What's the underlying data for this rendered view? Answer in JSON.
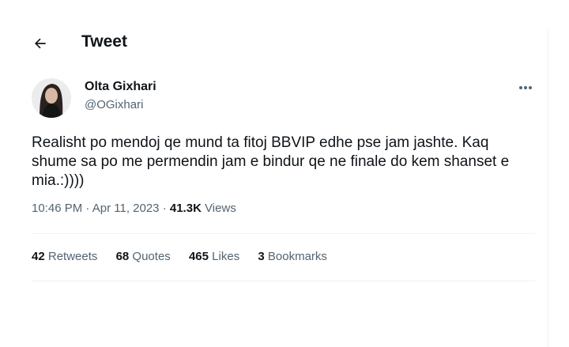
{
  "header": {
    "title": "Tweet"
  },
  "tweet": {
    "display_name": "Olta Gixhari",
    "handle": "@OGixhari",
    "text": "Realisht po mendoj qe mund ta fitoj BBVIP edhe pse jam jashte. Kaq shume sa po me permendin jam e bindur qe ne finale do kem shanset e mia.:))))",
    "time": "10:46 PM",
    "separator": "·",
    "date": "Apr 11, 2023",
    "views_count": "41.3K",
    "views_label": "Views"
  },
  "stats": {
    "retweets_count": "42",
    "retweets_label": "Retweets",
    "quotes_count": "68",
    "quotes_label": "Quotes",
    "likes_count": "465",
    "likes_label": "Likes",
    "bookmarks_count": "3",
    "bookmarks_label": "Bookmarks"
  },
  "icons": {
    "back": "arrow-left-icon",
    "more": "more-horizontal-icon"
  },
  "colors": {
    "text": "#0f1419",
    "secondary": "#536471",
    "divider": "#eff3f4",
    "background": "#ffffff"
  }
}
